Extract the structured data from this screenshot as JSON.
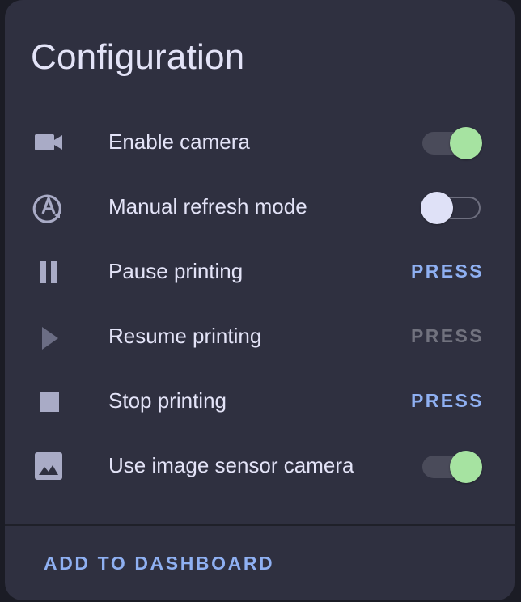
{
  "card": {
    "title": "Configuration"
  },
  "rows": [
    {
      "label": "Enable camera",
      "icon": "video-camera-icon",
      "control": "toggle",
      "state": "on"
    },
    {
      "label": "Manual refresh mode",
      "icon": "auto-refresh-icon",
      "control": "toggle",
      "state": "off"
    },
    {
      "label": "Pause printing",
      "icon": "pause-icon",
      "control": "button",
      "button_label": "PRESS",
      "enabled": true
    },
    {
      "label": "Resume printing",
      "icon": "play-icon",
      "control": "button",
      "button_label": "PRESS",
      "enabled": false
    },
    {
      "label": "Stop printing",
      "icon": "stop-icon",
      "control": "button",
      "button_label": "PRESS",
      "enabled": true
    },
    {
      "label": "Use image sensor camera",
      "icon": "image-icon",
      "control": "toggle",
      "state": "on"
    }
  ],
  "footer": {
    "action_label": "ADD TO DASHBOARD"
  },
  "colors": {
    "background": "#1b1c25",
    "card": "#2f3040",
    "text": "#e3e3f7",
    "icon": "#a9abc6",
    "accent": "#8fb0f2",
    "toggle_on": "#a6e3a1",
    "toggle_off_knob": "#dfe1f7",
    "disabled": "#71727e"
  }
}
